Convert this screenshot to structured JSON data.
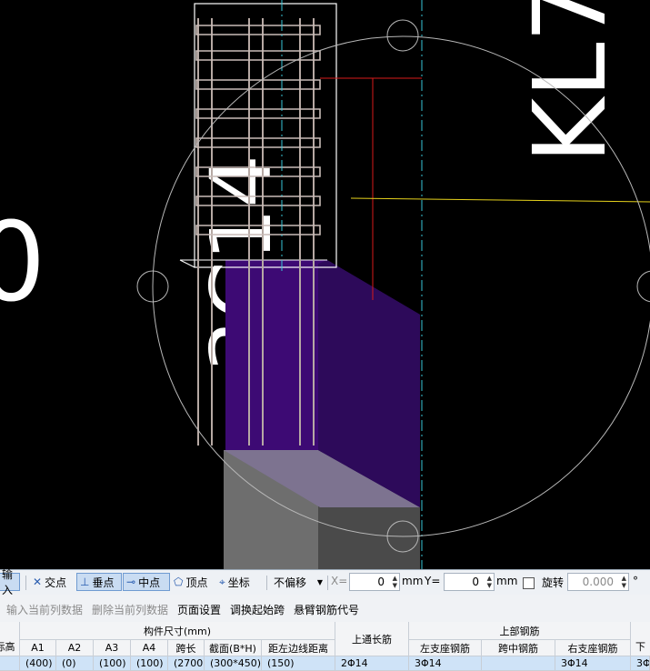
{
  "canvas": {
    "left_text": "0",
    "vertical_text": "3C14",
    "right_text": "KL7"
  },
  "snap_toolbar": {
    "input_label": "输入",
    "intersection_label": "交点",
    "perpendicular_label": "垂点",
    "midpoint_label": "中点",
    "vertex_label": "顶点",
    "coordinate_label": "坐标",
    "offset_select_value": "不偏移",
    "x_label": "X=",
    "x_value": "0",
    "x_unit": "mm",
    "y_label": "Y=",
    "y_value": "0",
    "y_unit": "mm",
    "rotate_label": "旋转",
    "rotate_value": "0.000",
    "degree_symbol": "°"
  },
  "grid_toolbar": {
    "input_column": "输入当前列数据",
    "delete_column": "删除当前列数据",
    "page_setup": "页面设置",
    "swap_start_span": "调换起始跨",
    "cantilever_code": "悬臂钢筋代号"
  },
  "table": {
    "col_elevation": "标高",
    "group_dimensions": "构件尺寸(mm)",
    "col_a1": "A1",
    "col_a2": "A2",
    "col_a3": "A3",
    "col_a4": "A4",
    "col_span_length": "跨长",
    "col_section": "截面(B*H)",
    "col_edge_distance": "距左边线距离",
    "col_top_through": "上通长筋",
    "group_top_rebar": "上部钢筋",
    "col_left_support": "左支座钢筋",
    "col_mid_span": "跨中钢筋",
    "col_right_support": "右支座钢筋",
    "col_next": "下",
    "row": {
      "a1": "(400)",
      "a2": "(0)",
      "a3": "(100)",
      "a4": "(100)",
      "span_length": "(2700)",
      "section": "(300*450)",
      "edge_distance": "(150)",
      "top_through": "2Φ14",
      "left_support": "3Φ14",
      "mid_span": "",
      "right_support": "3Φ14",
      "next": "3Φ"
    }
  }
}
